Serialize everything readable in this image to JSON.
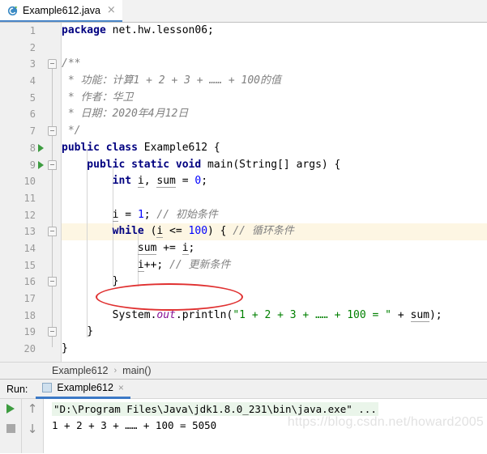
{
  "tab": {
    "label": "Example612.java",
    "icon": "java-class-icon",
    "close": "×"
  },
  "editor": {
    "lines": [
      {
        "n": "1",
        "indent_guides": 0,
        "marker": "",
        "fold": "",
        "segments": [
          {
            "t": "package ",
            "c": "kw"
          },
          {
            "t": "net.hw.lesson06;",
            "c": "plain"
          }
        ]
      },
      {
        "n": "2",
        "indent_guides": 0,
        "marker": "",
        "fold": "",
        "segments": []
      },
      {
        "n": "3",
        "indent_guides": 0,
        "marker": "",
        "fold": "open",
        "segments": [
          {
            "t": "/**",
            "c": "jdoc"
          }
        ]
      },
      {
        "n": "4",
        "indent_guides": 0,
        "marker": "",
        "fold": "",
        "segments": [
          {
            "t": " * 功能：计算1 + 2 + 3 + …… + 100的值",
            "c": "jdoc"
          }
        ]
      },
      {
        "n": "5",
        "indent_guides": 0,
        "marker": "",
        "fold": "",
        "segments": [
          {
            "t": " * 作者：华卫",
            "c": "jdoc"
          }
        ]
      },
      {
        "n": "6",
        "indent_guides": 0,
        "marker": "",
        "fold": "",
        "segments": [
          {
            "t": " * 日期：2020年4月12日",
            "c": "jdoc"
          }
        ]
      },
      {
        "n": "7",
        "indent_guides": 0,
        "marker": "",
        "fold": "close",
        "segments": [
          {
            "t": " */",
            "c": "jdoc"
          }
        ]
      },
      {
        "n": "8",
        "indent_guides": 0,
        "marker": "run",
        "fold": "",
        "segments": [
          {
            "t": "public class ",
            "c": "kw"
          },
          {
            "t": "Example612 {",
            "c": "plain"
          }
        ]
      },
      {
        "n": "9",
        "indent_guides": 1,
        "marker": "run",
        "fold": "open",
        "segments": [
          {
            "t": "    public static void ",
            "c": "kw"
          },
          {
            "t": "main(String[] args) {",
            "c": "plain"
          }
        ]
      },
      {
        "n": "10",
        "indent_guides": 2,
        "marker": "",
        "fold": "",
        "segments": [
          {
            "t": "        int ",
            "c": "kw"
          },
          {
            "t": "i",
            "c": "var"
          },
          {
            "t": ", ",
            "c": "plain"
          },
          {
            "t": "sum",
            "c": "var"
          },
          {
            "t": " = ",
            "c": "plain"
          },
          {
            "t": "0",
            "c": "num"
          },
          {
            "t": ";",
            "c": "plain"
          }
        ]
      },
      {
        "n": "11",
        "indent_guides": 2,
        "marker": "",
        "fold": "",
        "segments": []
      },
      {
        "n": "12",
        "indent_guides": 2,
        "marker": "",
        "fold": "",
        "segments": [
          {
            "t": "        ",
            "c": "plain"
          },
          {
            "t": "i",
            "c": "var"
          },
          {
            "t": " = ",
            "c": "plain"
          },
          {
            "t": "1",
            "c": "num"
          },
          {
            "t": "; ",
            "c": "plain"
          },
          {
            "t": "// 初始条件",
            "c": "cmt"
          }
        ]
      },
      {
        "n": "13",
        "indent_guides": 2,
        "marker": "",
        "fold": "open",
        "highlight": true,
        "segments": [
          {
            "t": "        while ",
            "c": "kw"
          },
          {
            "t": "(",
            "c": "plain"
          },
          {
            "t": "i",
            "c": "var"
          },
          {
            "t": " <= ",
            "c": "plain"
          },
          {
            "t": "100",
            "c": "num"
          },
          {
            "t": ") { ",
            "c": "plain"
          },
          {
            "t": "// 循环条件",
            "c": "cmt"
          }
        ]
      },
      {
        "n": "14",
        "indent_guides": 3,
        "marker": "",
        "fold": "",
        "segments": [
          {
            "t": "            ",
            "c": "plain"
          },
          {
            "t": "sum",
            "c": "var"
          },
          {
            "t": " += ",
            "c": "plain"
          },
          {
            "t": "i",
            "c": "var"
          },
          {
            "t": ";",
            "c": "plain"
          }
        ]
      },
      {
        "n": "15",
        "indent_guides": 3,
        "marker": "",
        "fold": "",
        "segments": [
          {
            "t": "            ",
            "c": "plain"
          },
          {
            "t": "i",
            "c": "var"
          },
          {
            "t": "++; ",
            "c": "plain"
          },
          {
            "t": "// 更新条件",
            "c": "cmt"
          }
        ]
      },
      {
        "n": "16",
        "indent_guides": 2,
        "marker": "",
        "fold": "close",
        "segments": [
          {
            "t": "        }",
            "c": "plain"
          }
        ]
      },
      {
        "n": "17",
        "indent_guides": 2,
        "marker": "",
        "fold": "",
        "segments": []
      },
      {
        "n": "18",
        "indent_guides": 2,
        "marker": "",
        "fold": "",
        "segments": [
          {
            "t": "        System.",
            "c": "plain"
          },
          {
            "t": "out",
            "c": "field"
          },
          {
            "t": ".println(",
            "c": "plain"
          },
          {
            "t": "\"1 + 2 + 3 + …… + 100 = \"",
            "c": "str"
          },
          {
            "t": " + ",
            "c": "plain"
          },
          {
            "t": "sum",
            "c": "var"
          },
          {
            "t": ");",
            "c": "plain"
          }
        ]
      },
      {
        "n": "19",
        "indent_guides": 1,
        "marker": "",
        "fold": "close",
        "segments": [
          {
            "t": "    }",
            "c": "plain"
          }
        ]
      },
      {
        "n": "20",
        "indent_guides": 0,
        "marker": "",
        "fold": "",
        "segments": [
          {
            "t": "}",
            "c": "plain"
          }
        ]
      }
    ],
    "annotation": {
      "shape": "red-ellipse",
      "target": "i++; // 更新条件"
    }
  },
  "breadcrumb": {
    "class": "Example612",
    "separator": "›",
    "method": "main()"
  },
  "run_window": {
    "title": "Run:",
    "tab_label": "Example612",
    "tab_close": "×",
    "buttons": {
      "rerun": "rerun-icon",
      "stop": "stop-icon",
      "up": "↑",
      "down": "↓"
    },
    "console": {
      "command": "\"D:\\Program Files\\Java\\jdk1.8.0_231\\bin\\java.exe\" ...",
      "output": "1 + 2 + 3 + …… + 100 = 5050"
    },
    "watermark": "https://blog.csdn.net/howard2005"
  },
  "colors": {
    "accent": "#3c79c6",
    "keyword": "#000080",
    "string": "#008000",
    "comment": "#808080",
    "number": "#0000ff",
    "annotation": "#e03030",
    "highlight_line": "#fdf6e3"
  }
}
